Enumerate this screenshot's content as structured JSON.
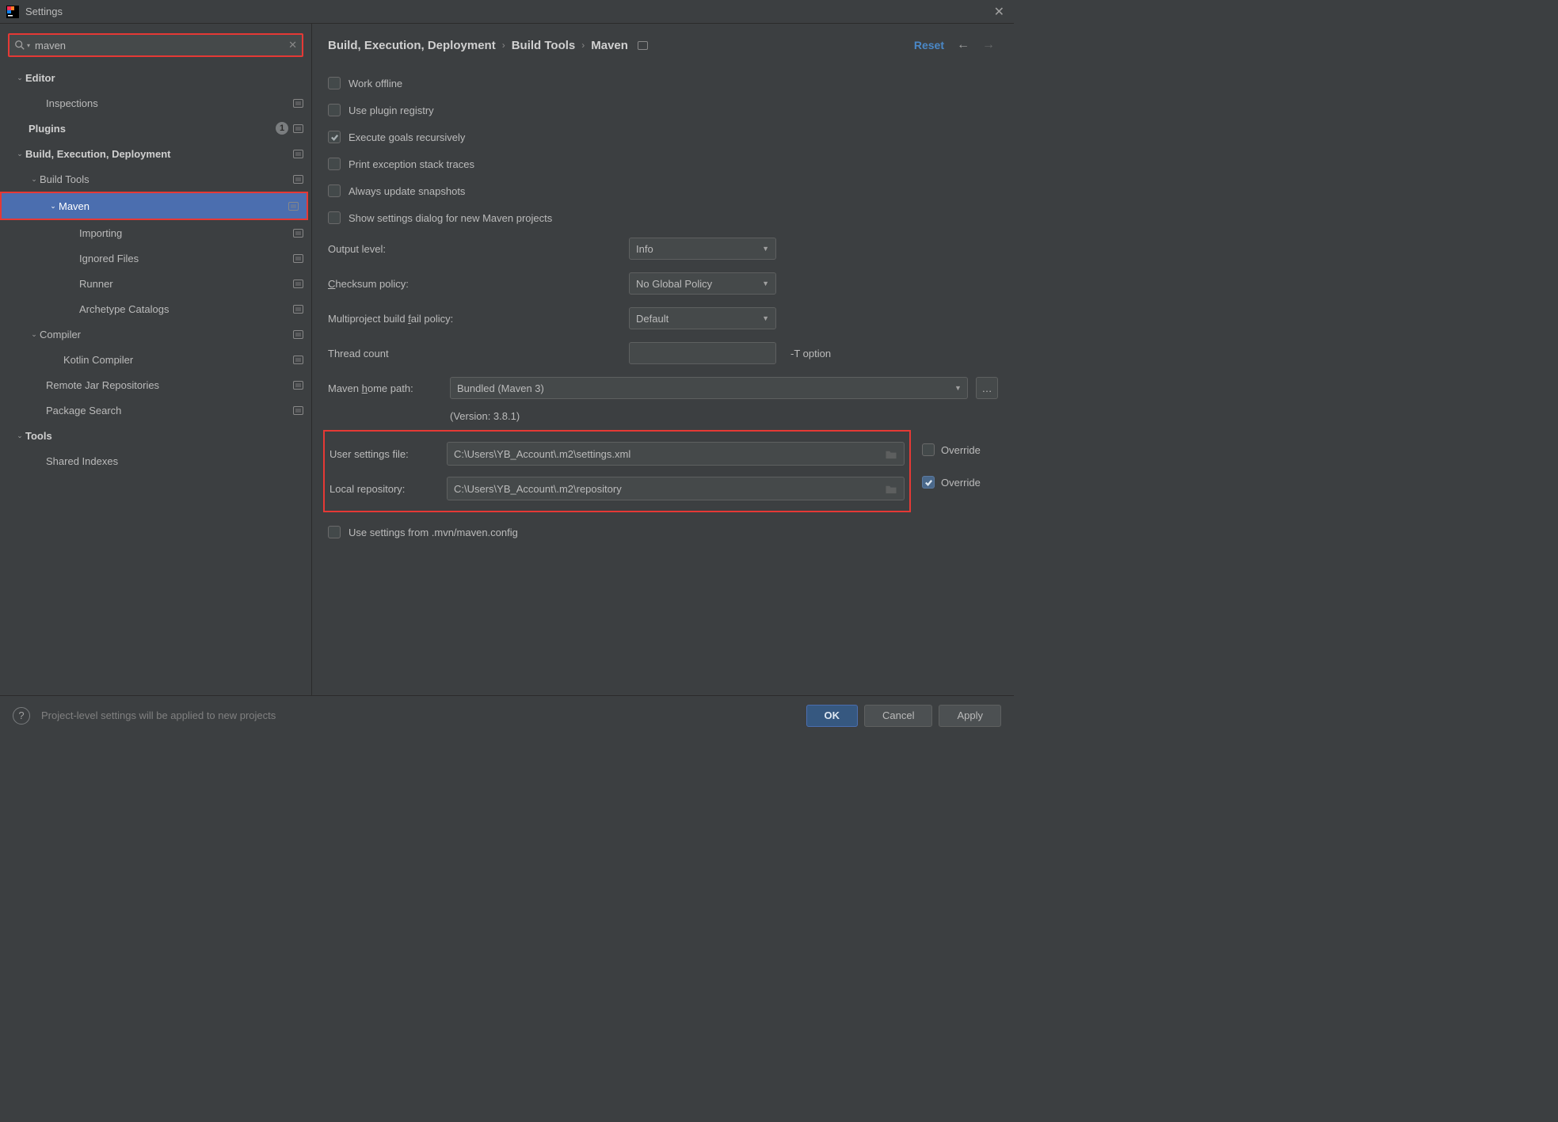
{
  "title": "Settings",
  "search": {
    "value": "maven"
  },
  "sidebar": {
    "editor": "Editor",
    "inspections": "Inspections",
    "plugins": "Plugins",
    "plugins_badge": "1",
    "bed": "Build, Execution, Deployment",
    "buildtools": "Build Tools",
    "maven": "Maven",
    "importing": "Importing",
    "ignored": "Ignored Files",
    "runner": "Runner",
    "archetype": "Archetype Catalogs",
    "compiler": "Compiler",
    "kotlin": "Kotlin Compiler",
    "remote": "Remote Jar Repositories",
    "pkgsearch": "Package Search",
    "tools": "Tools",
    "shared": "Shared Indexes"
  },
  "breadcrumb": {
    "a": "Build, Execution, Deployment",
    "b": "Build Tools",
    "c": "Maven"
  },
  "actions": {
    "reset": "Reset"
  },
  "checks": {
    "offline": "Work offline",
    "plugin": "Use plugin registry",
    "recursive": "Execute goals recursively",
    "stack": "Print exception stack traces",
    "snapshots": "Always update snapshots",
    "dialog": "Show settings dialog for new Maven projects",
    "mvnconfig": "Use settings from .mvn/maven.config"
  },
  "fields": {
    "output": {
      "label": "Output level:",
      "value": "Info"
    },
    "checksum": {
      "label_pre": "",
      "label_u": "C",
      "label_post": "hecksum policy:",
      "value": "No Global Policy"
    },
    "fail": {
      "label_pre": "Multiproject build ",
      "label_u": "f",
      "label_post": "ail policy:",
      "value": "Default"
    },
    "thread": {
      "label": "Thread count",
      "value": "",
      "suffix": "-T option"
    },
    "home": {
      "label_pre": "Maven ",
      "label_u": "h",
      "label_post": "ome path:",
      "value": "Bundled (Maven 3)",
      "version": "(Version: 3.8.1)"
    },
    "user": {
      "label_pre": "User ",
      "label_u": "s",
      "label_post": "ettings file:",
      "value": "C:\\Users\\YB_Account\\.m2\\settings.xml"
    },
    "repo": {
      "label_pre": "Local ",
      "label_u": "r",
      "label_post": "epository:",
      "value": "C:\\Users\\YB_Account\\.m2\\repository"
    },
    "override": "Override"
  },
  "footer": {
    "note": "Project-level settings will be applied to new projects",
    "ok": "OK",
    "cancel": "Cancel",
    "apply": "Apply"
  }
}
